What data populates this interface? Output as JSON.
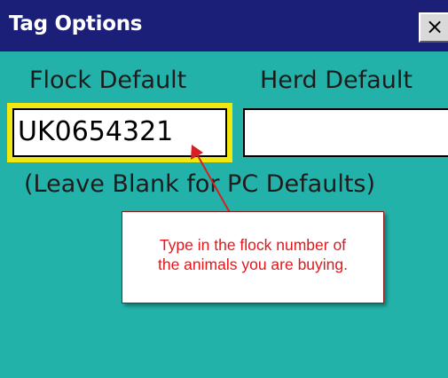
{
  "window": {
    "title": "Tag Options",
    "close_icon": "close-icon",
    "close_glyph": "×"
  },
  "form": {
    "flock_label": "Flock Default",
    "herd_label": "Herd Default",
    "flock_value": "UK0654321",
    "herd_value": "",
    "hint": "(Leave Blank for PC Defaults)"
  },
  "annotation": {
    "line1": "Type in the flock number of",
    "line2": "the animals you are buying."
  },
  "colors": {
    "background": "#23b2aa",
    "titlebar": "#1b1f77",
    "highlight": "#f2e70e",
    "callout_text": "#e2161b"
  }
}
